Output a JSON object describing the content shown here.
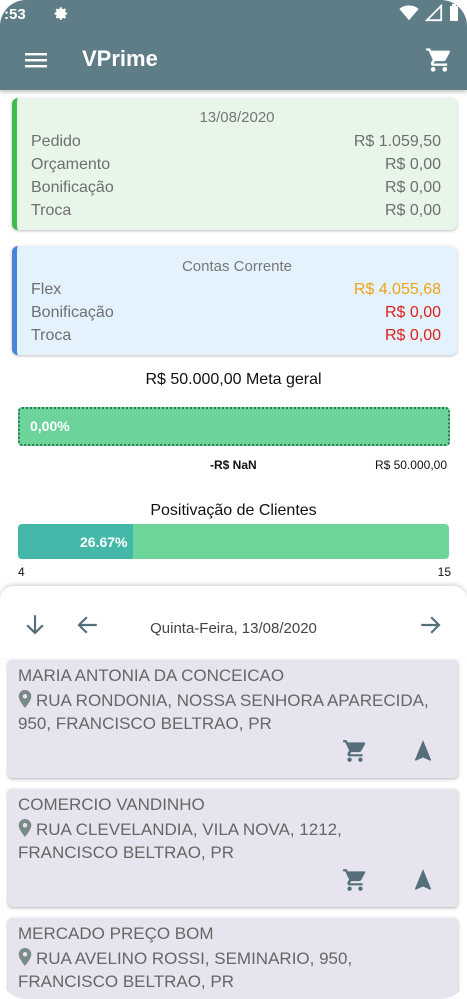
{
  "statusbar": {
    "time": ":53"
  },
  "appbar": {
    "title": "VPrime"
  },
  "summary": {
    "date": "13/08/2020",
    "rows": [
      {
        "label": "Pedido",
        "value": "R$ 1.059,50"
      },
      {
        "label": "Orçamento",
        "value": "R$ 0,00"
      },
      {
        "label": "Bonificação",
        "value": "R$ 0,00"
      },
      {
        "label": "Troca",
        "value": "R$ 0,00"
      }
    ]
  },
  "contas": {
    "title": "Contas Corrente",
    "rows": [
      {
        "label": "Flex",
        "value": "R$ 4.055,68",
        "color": "#f0a21a"
      },
      {
        "label": "Bonificação",
        "value": "R$ 0,00",
        "color": "#e0201c"
      },
      {
        "label": "Troca",
        "value": "R$ 0,00",
        "color": "#e0201c"
      }
    ]
  },
  "meta": {
    "title": "R$ 50.000,00 Meta geral",
    "percent_label": "0,00%",
    "progress": 0,
    "left_value": "-R$ NaN",
    "right_value": "R$ 50.000,00"
  },
  "positivacao": {
    "title": "Positivação de Clientes",
    "percent_label": "26.67%",
    "progress": 0.2667,
    "min": "4",
    "max": "15"
  },
  "datenav": {
    "date": "Quinta-Feira, 13/08/2020"
  },
  "clients": [
    {
      "name": "MARIA ANTONIA DA CONCEICAO",
      "address": "RUA RONDONIA, NOSSA SENHORA APARECIDA, 950, FRANCISCO BELTRAO, PR"
    },
    {
      "name": "COMERCIO VANDINHO",
      "address": "RUA CLEVELANDIA, VILA NOVA, 1212, FRANCISCO BELTRAO, PR"
    },
    {
      "name": "MERCADO PREÇO BOM",
      "address": "RUA AVELINO ROSSI, SEMINARIO, 950, FRANCISCO BELTRAO, PR"
    }
  ],
  "colors": {
    "appbar": "#5f7d87",
    "accent_green": "#3dbb4e",
    "accent_blue": "#4a83d9",
    "progress_green": "#6cd39a",
    "progress_teal": "#44b8a8",
    "client_bg": "#e8e4ef",
    "action_icon": "#546e7a"
  }
}
